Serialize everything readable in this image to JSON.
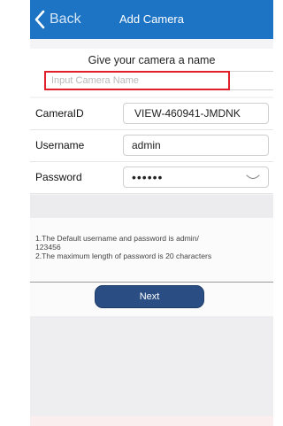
{
  "nav": {
    "back_label": "Back",
    "title": "Add Camera"
  },
  "name_section": {
    "heading": "Give your camera a name",
    "input_placeholder": "Input Camera Name",
    "input_value": ""
  },
  "form": {
    "camera_id": {
      "label": "CameraID",
      "value": "VIEW-460941-JMDNK"
    },
    "username": {
      "label": "Username",
      "value": "admin"
    },
    "password": {
      "label": "Password",
      "value": "123456"
    }
  },
  "info": {
    "line1": "1.The Default username and password is admin/",
    "line2": "123456",
    "line3": "2.The maximum length of password is 20 characters"
  },
  "next_button": {
    "label": "Next"
  },
  "colors": {
    "nav_bar": "#1d74c4",
    "next_button": "#2a4e84",
    "name_input_highlight": "#e0202a"
  },
  "icons": {
    "back": "chevron-left-icon",
    "password_toggle": "eye-icon"
  }
}
